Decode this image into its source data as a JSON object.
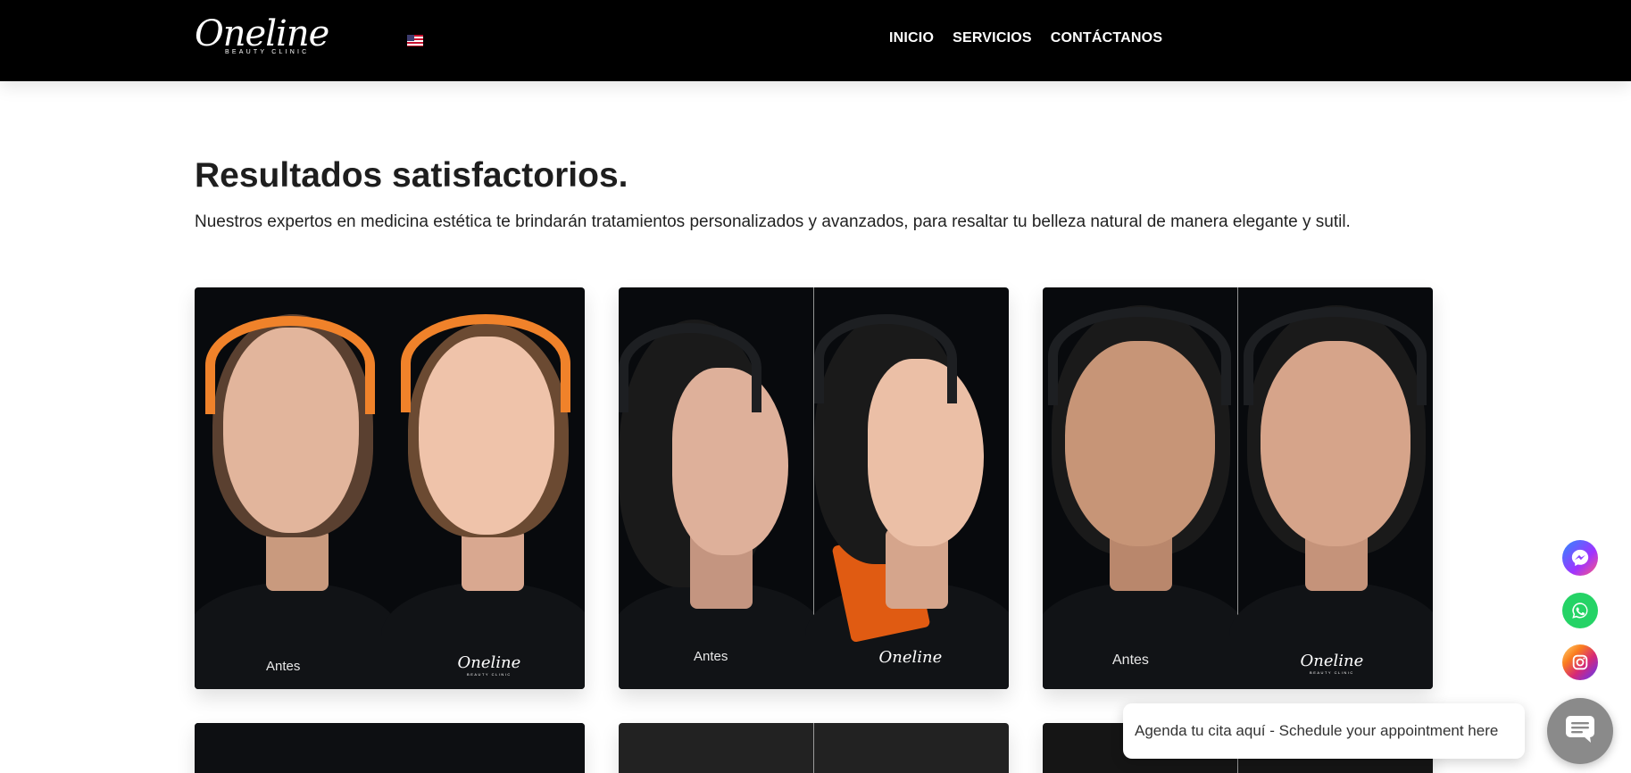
{
  "header": {
    "logo_text": "Oneline",
    "logo_tagline": "BEAUTY CLINIC",
    "language_flag": "us-flag-icon",
    "nav": [
      {
        "label": "INICIO"
      },
      {
        "label": "SERVICIOS"
      },
      {
        "label": "CONTÁCTANOS"
      }
    ]
  },
  "section": {
    "title": "Resultados satisfactorios.",
    "subtitle": "Nuestros expertos en medicina estética te brindarán tratamientos personalizados y avanzados, para resaltar tu belleza natural de manera elegante y sutil."
  },
  "gallery": {
    "cards": [
      {
        "before_label": "Antes",
        "watermark": "Oneline",
        "watermark_tag": "BEAUTY CLINIC"
      },
      {
        "before_label": "Antes",
        "watermark": "Oneline"
      },
      {
        "before_label": "Antes",
        "watermark": "Oneline",
        "watermark_tag": "BEAUTY CLINIC"
      }
    ]
  },
  "floating": {
    "icons": [
      "messenger-icon",
      "whatsapp-icon",
      "instagram-icon"
    ],
    "chat_prompt": "Agenda tu cita aquí - Schedule your appointment here",
    "chat_icon": "chat-icon"
  },
  "colors": {
    "header_bg": "#000000",
    "headband": "#f0822a",
    "whatsapp": "#25d366",
    "chat_button": "#8a8a8a"
  }
}
